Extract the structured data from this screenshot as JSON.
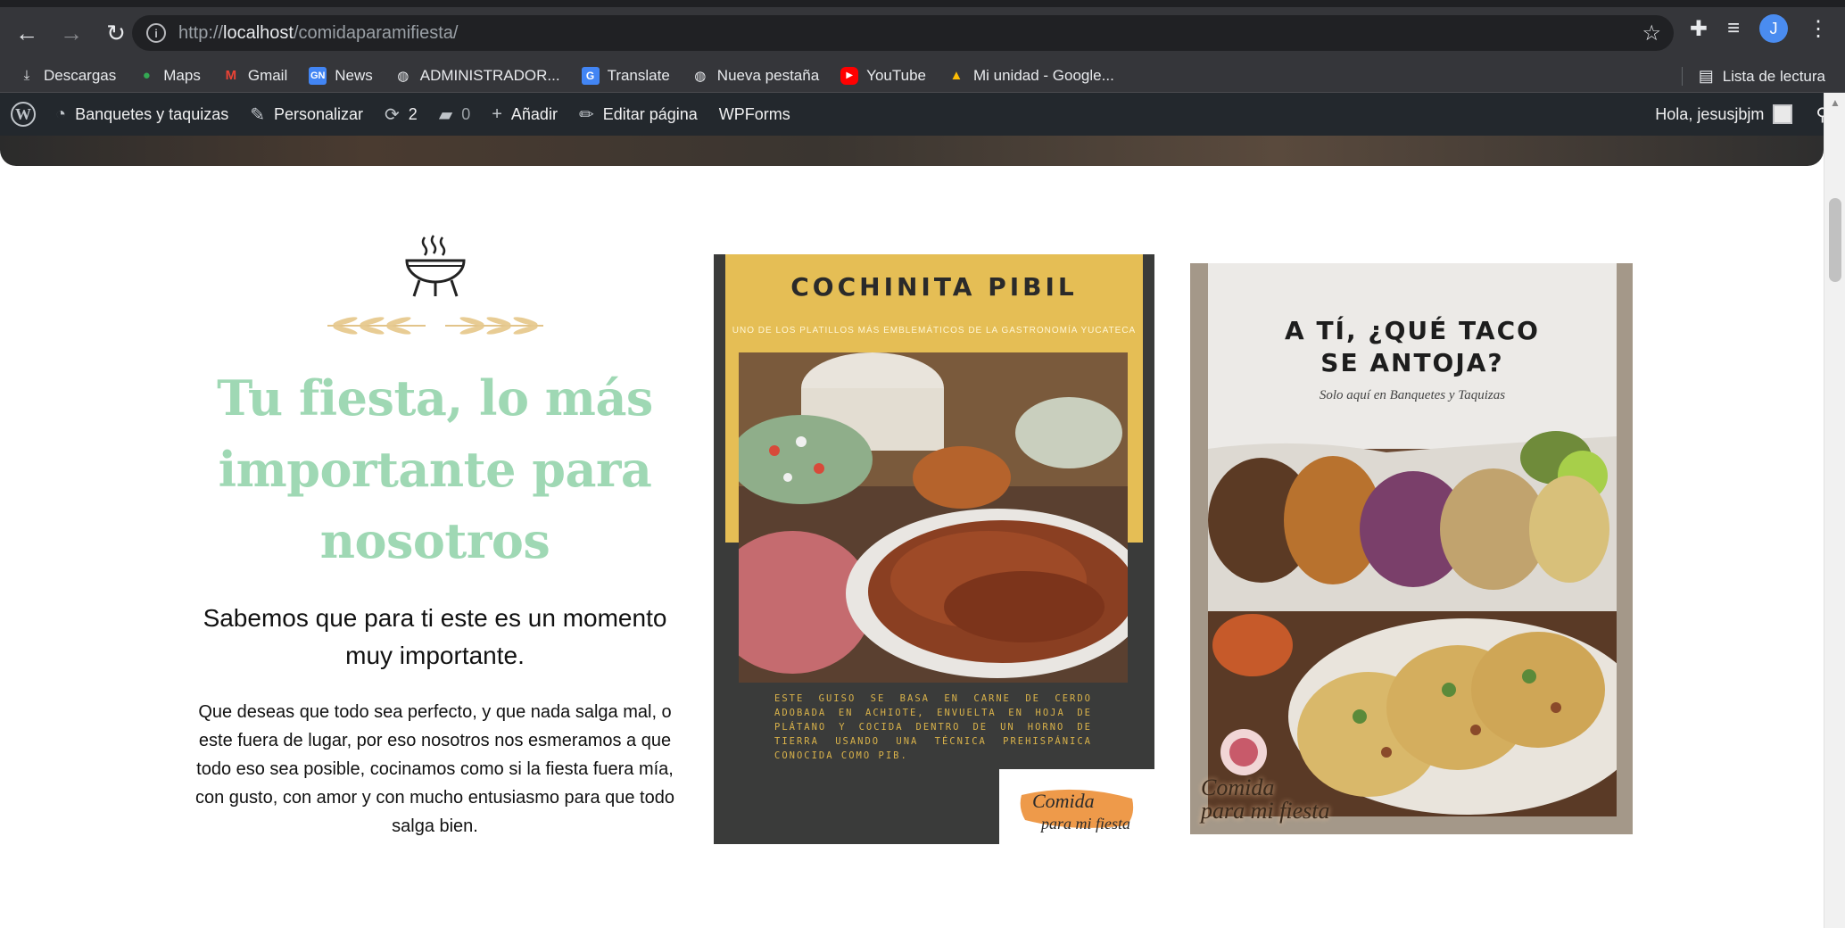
{
  "browser": {
    "url_prefix": "http://",
    "url_host": "localhost",
    "url_path": "/comidaparamifiesta/",
    "profile_initial": "J"
  },
  "bookmarks": {
    "items": [
      {
        "label": "Descargas",
        "icon": "download-icon"
      },
      {
        "label": "Maps",
        "icon": "maps-icon"
      },
      {
        "label": "Gmail",
        "icon": "gmail-icon"
      },
      {
        "label": "News",
        "icon": "news-icon"
      },
      {
        "label": "ADMINISTRADOR...",
        "icon": "globe-icon"
      },
      {
        "label": "Translate",
        "icon": "translate-icon"
      },
      {
        "label": "Nueva pestaña",
        "icon": "globe-icon"
      },
      {
        "label": "YouTube",
        "icon": "youtube-icon"
      },
      {
        "label": "Mi unidad - Google...",
        "icon": "drive-icon"
      }
    ],
    "reading_list": "Lista de lectura"
  },
  "wpbar": {
    "site_name": "Banquetes y taquizas",
    "customize": "Personalizar",
    "updates_count": "2",
    "comments_count": "0",
    "add_new": "Añadir",
    "edit_page": "Editar página",
    "wpforms": "WPForms",
    "greeting": "Hola, jesusjbjm"
  },
  "intro": {
    "headline_line1": "Tu fiesta, lo más",
    "headline_line2": "importante para",
    "headline_line3": "nosotros",
    "subhead": "Sabemos que para ti este es un momento muy importante.",
    "body": "Que deseas que todo sea perfecto, y que nada salga mal, o este fuera de lugar, por eso nosotros nos esmeramos a que todo eso sea posible, cocinamos como si la fiesta fuera mía, con gusto, con amor y con mucho entusiasmo para que todo salga bien."
  },
  "card_cochinita": {
    "title": "COCHINITA PIBIL",
    "tagline": "UNO DE LOS PLATILLOS MÁS EMBLEMÁTICOS DE LA GASTRONOMÍA YUCATECA",
    "description": "ESTE GUISO SE BASA EN CARNE DE CERDO ADOBADA EN ACHIOTE, ENVUELTA EN HOJA DE PLÁTANO Y COCIDA DENTRO DE UN HORNO DE TIERRA USANDO UNA TÉCNICA PREHISPÁNICA CONOCIDA COMO PIB.",
    "logo_line1": "Comida",
    "logo_line2": "para mi fiesta"
  },
  "card_tacos": {
    "title_line1": "A TÍ, ¿QUÉ TACO",
    "title_line2": "SE ANTOJA?",
    "subtitle": "Solo aquí en Banquetes y Taquizas",
    "brand_line1": "Comida",
    "brand_line2": "para mi fiesta"
  },
  "colors": {
    "headline": "#9fd8b4",
    "card_yellow": "#e5be55",
    "card_dark": "#3a3b3a",
    "wpbar": "#23282d",
    "chrome": "#35363a"
  }
}
